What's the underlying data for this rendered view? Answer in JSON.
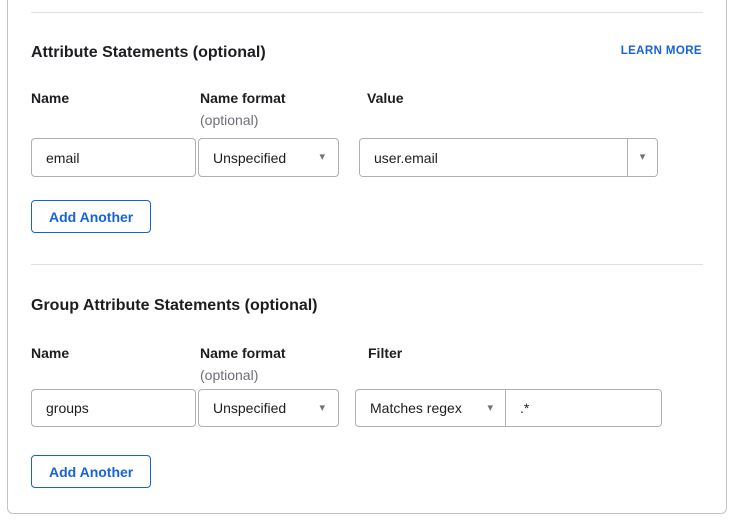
{
  "colors": {
    "accent": "#1662dd",
    "text": "#1d1d21",
    "muted_text": "#6e6e78",
    "field_border": "#aeaeb4",
    "panel_border": "#c2c2c7",
    "divider": "#e0e0e3"
  },
  "icons": {
    "chevron_down": "▾"
  },
  "attribute_statements": {
    "heading": "Attribute Statements (optional)",
    "learn_more_link": "LEARN MORE",
    "col_name": "Name",
    "col_name_format": "Name format",
    "col_name_format_note": "(optional)",
    "col_value": "Value",
    "rows": [
      {
        "name": "email",
        "name_format": "Unspecified",
        "value": "user.email"
      }
    ],
    "add_button": "Add Another"
  },
  "group_attribute_statements": {
    "heading": "Group Attribute Statements (optional)",
    "col_name": "Name",
    "col_name_format": "Name format",
    "col_name_format_note": "(optional)",
    "col_filter": "Filter",
    "rows": [
      {
        "name": "groups",
        "name_format": "Unspecified",
        "filter_type": "Matches regex",
        "filter_value": ".*"
      }
    ],
    "add_button": "Add Another"
  }
}
